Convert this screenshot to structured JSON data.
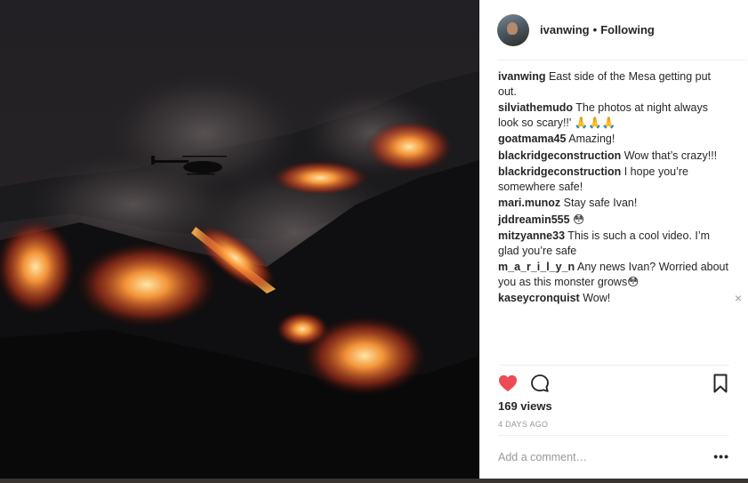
{
  "post": {
    "username": "ivanwing",
    "separator": "•",
    "follow_status": "Following"
  },
  "comments": [
    {
      "user": "ivanwing",
      "text": "East side of the Mesa getting put out."
    },
    {
      "user": "silviathemudo",
      "text": "The photos at night always look so scary!!' 🙏🙏🙏"
    },
    {
      "user": "goatmama45",
      "text": "Amazing!"
    },
    {
      "user": "blackridgeconstruction",
      "text": "Wow that’s crazy!!!"
    },
    {
      "user": "blackridgeconstruction",
      "text": "I hope you’re somewhere safe!"
    },
    {
      "user": "mari.munoz",
      "text": "Stay safe Ivan!"
    },
    {
      "user": "jddreamin555",
      "text": "😳"
    },
    {
      "user": "mitzyanne33",
      "text": "This is such a cool video. I’m glad you’re safe"
    },
    {
      "user": "m_a_r_i_l_y_n",
      "text": "Any news Ivan? Worried about you as this monster grows😳"
    },
    {
      "user": "kaseycronquist",
      "text": "Wow!"
    }
  ],
  "close_glyph": "×",
  "stats": {
    "views": "169 views",
    "time": "4 DAYS AGO"
  },
  "comment_box": {
    "placeholder": "Add a comment…",
    "more_glyph": "•••"
  },
  "icons": {
    "like": "heart-icon",
    "comment": "comment-icon",
    "save": "bookmark-icon",
    "more": "more-options-icon"
  },
  "colors": {
    "like_red": "#ed4956",
    "text": "#262626",
    "muted": "#999999",
    "fire": "#ff8a2b"
  }
}
